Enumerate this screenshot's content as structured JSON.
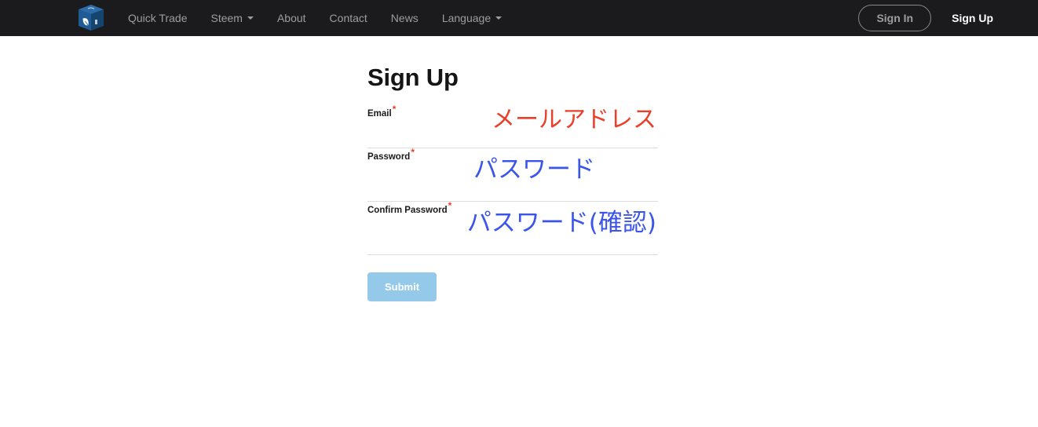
{
  "navbar": {
    "brand": {
      "icon": "cube-logo-icon",
      "alt": "Site logo"
    },
    "links": [
      {
        "label": "Quick Trade",
        "has_caret": false,
        "name": "nav-link-quick-trade"
      },
      {
        "label": "Steem",
        "has_caret": true,
        "name": "nav-link-steem"
      },
      {
        "label": "About",
        "has_caret": false,
        "name": "nav-link-about"
      },
      {
        "label": "Contact",
        "has_caret": false,
        "name": "nav-link-contact"
      },
      {
        "label": "News",
        "has_caret": false,
        "name": "nav-link-news"
      },
      {
        "label": "Language",
        "has_caret": true,
        "name": "nav-link-language"
      }
    ],
    "sign_in_label": "Sign In",
    "sign_up_label": "Sign Up"
  },
  "form": {
    "title": "Sign Up",
    "fields": [
      {
        "label": "Email",
        "required_mark": "*",
        "value": "メールアドレス"
      },
      {
        "label": "Password",
        "required_mark": "*",
        "value": "パスワード"
      },
      {
        "label": "Confirm Password",
        "required_mark": "*",
        "value": "パスワード(確認)"
      }
    ],
    "submit_label": "Submit"
  },
  "colors": {
    "navbar_bg": "#1b1b1d",
    "nav_text": "#9d9d9d",
    "accent_red": "#e8402a",
    "accent_blue": "#3b55e8",
    "submit_bg": "#94c9e9",
    "logo_blue": "#1c5f9e"
  }
}
